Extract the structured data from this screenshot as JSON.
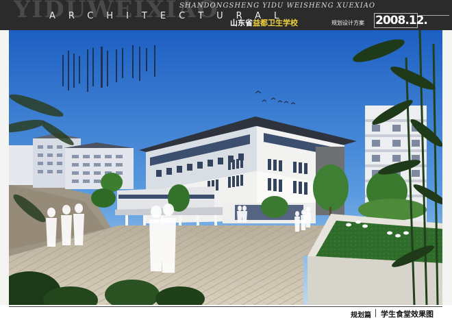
{
  "header": {
    "watermark": "YIDUWEIXIAO",
    "architectural": "ARCHITECTURAL",
    "pinyin": "SHANDONGSHENG YIDU WEISHENG XUEXIAO",
    "title_prefix": "山东省",
    "title_highlight": "益都卫生学校",
    "subtitle": "规划设计方案",
    "year": "2008.12."
  },
  "footer": {
    "label": "规划篇",
    "title": "学生食堂效果图"
  },
  "colors": {
    "header_bg": "#2b2b2b",
    "accent_yellow": "#f0d23a",
    "sky": "#3f7fd0"
  }
}
